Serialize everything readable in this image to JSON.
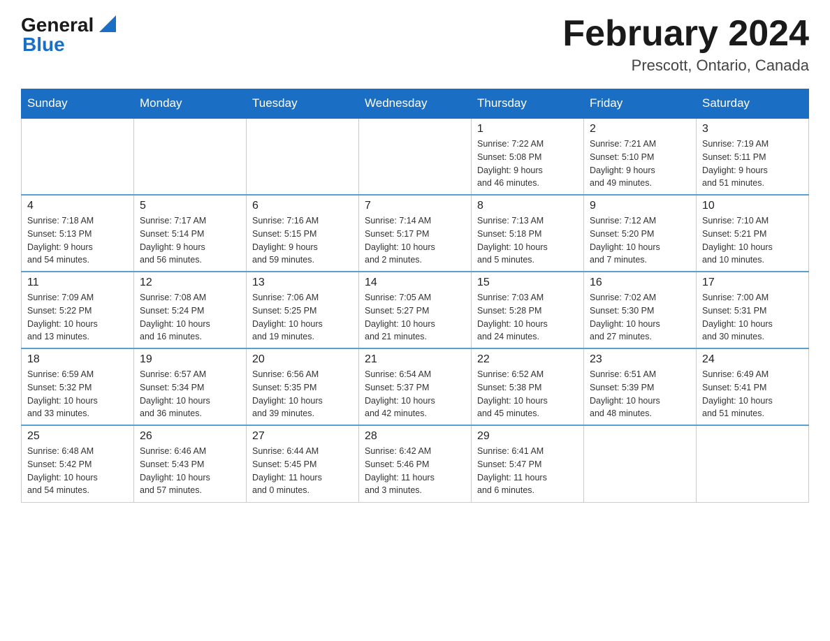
{
  "header": {
    "logo_general": "General",
    "logo_blue": "Blue",
    "month_title": "February 2024",
    "location": "Prescott, Ontario, Canada"
  },
  "weekdays": [
    "Sunday",
    "Monday",
    "Tuesday",
    "Wednesday",
    "Thursday",
    "Friday",
    "Saturday"
  ],
  "weeks": [
    [
      {
        "day": "",
        "info": ""
      },
      {
        "day": "",
        "info": ""
      },
      {
        "day": "",
        "info": ""
      },
      {
        "day": "",
        "info": ""
      },
      {
        "day": "1",
        "info": "Sunrise: 7:22 AM\nSunset: 5:08 PM\nDaylight: 9 hours\nand 46 minutes."
      },
      {
        "day": "2",
        "info": "Sunrise: 7:21 AM\nSunset: 5:10 PM\nDaylight: 9 hours\nand 49 minutes."
      },
      {
        "day": "3",
        "info": "Sunrise: 7:19 AM\nSunset: 5:11 PM\nDaylight: 9 hours\nand 51 minutes."
      }
    ],
    [
      {
        "day": "4",
        "info": "Sunrise: 7:18 AM\nSunset: 5:13 PM\nDaylight: 9 hours\nand 54 minutes."
      },
      {
        "day": "5",
        "info": "Sunrise: 7:17 AM\nSunset: 5:14 PM\nDaylight: 9 hours\nand 56 minutes."
      },
      {
        "day": "6",
        "info": "Sunrise: 7:16 AM\nSunset: 5:15 PM\nDaylight: 9 hours\nand 59 minutes."
      },
      {
        "day": "7",
        "info": "Sunrise: 7:14 AM\nSunset: 5:17 PM\nDaylight: 10 hours\nand 2 minutes."
      },
      {
        "day": "8",
        "info": "Sunrise: 7:13 AM\nSunset: 5:18 PM\nDaylight: 10 hours\nand 5 minutes."
      },
      {
        "day": "9",
        "info": "Sunrise: 7:12 AM\nSunset: 5:20 PM\nDaylight: 10 hours\nand 7 minutes."
      },
      {
        "day": "10",
        "info": "Sunrise: 7:10 AM\nSunset: 5:21 PM\nDaylight: 10 hours\nand 10 minutes."
      }
    ],
    [
      {
        "day": "11",
        "info": "Sunrise: 7:09 AM\nSunset: 5:22 PM\nDaylight: 10 hours\nand 13 minutes."
      },
      {
        "day": "12",
        "info": "Sunrise: 7:08 AM\nSunset: 5:24 PM\nDaylight: 10 hours\nand 16 minutes."
      },
      {
        "day": "13",
        "info": "Sunrise: 7:06 AM\nSunset: 5:25 PM\nDaylight: 10 hours\nand 19 minutes."
      },
      {
        "day": "14",
        "info": "Sunrise: 7:05 AM\nSunset: 5:27 PM\nDaylight: 10 hours\nand 21 minutes."
      },
      {
        "day": "15",
        "info": "Sunrise: 7:03 AM\nSunset: 5:28 PM\nDaylight: 10 hours\nand 24 minutes."
      },
      {
        "day": "16",
        "info": "Sunrise: 7:02 AM\nSunset: 5:30 PM\nDaylight: 10 hours\nand 27 minutes."
      },
      {
        "day": "17",
        "info": "Sunrise: 7:00 AM\nSunset: 5:31 PM\nDaylight: 10 hours\nand 30 minutes."
      }
    ],
    [
      {
        "day": "18",
        "info": "Sunrise: 6:59 AM\nSunset: 5:32 PM\nDaylight: 10 hours\nand 33 minutes."
      },
      {
        "day": "19",
        "info": "Sunrise: 6:57 AM\nSunset: 5:34 PM\nDaylight: 10 hours\nand 36 minutes."
      },
      {
        "day": "20",
        "info": "Sunrise: 6:56 AM\nSunset: 5:35 PM\nDaylight: 10 hours\nand 39 minutes."
      },
      {
        "day": "21",
        "info": "Sunrise: 6:54 AM\nSunset: 5:37 PM\nDaylight: 10 hours\nand 42 minutes."
      },
      {
        "day": "22",
        "info": "Sunrise: 6:52 AM\nSunset: 5:38 PM\nDaylight: 10 hours\nand 45 minutes."
      },
      {
        "day": "23",
        "info": "Sunrise: 6:51 AM\nSunset: 5:39 PM\nDaylight: 10 hours\nand 48 minutes."
      },
      {
        "day": "24",
        "info": "Sunrise: 6:49 AM\nSunset: 5:41 PM\nDaylight: 10 hours\nand 51 minutes."
      }
    ],
    [
      {
        "day": "25",
        "info": "Sunrise: 6:48 AM\nSunset: 5:42 PM\nDaylight: 10 hours\nand 54 minutes."
      },
      {
        "day": "26",
        "info": "Sunrise: 6:46 AM\nSunset: 5:43 PM\nDaylight: 10 hours\nand 57 minutes."
      },
      {
        "day": "27",
        "info": "Sunrise: 6:44 AM\nSunset: 5:45 PM\nDaylight: 11 hours\nand 0 minutes."
      },
      {
        "day": "28",
        "info": "Sunrise: 6:42 AM\nSunset: 5:46 PM\nDaylight: 11 hours\nand 3 minutes."
      },
      {
        "day": "29",
        "info": "Sunrise: 6:41 AM\nSunset: 5:47 PM\nDaylight: 11 hours\nand 6 minutes."
      },
      {
        "day": "",
        "info": ""
      },
      {
        "day": "",
        "info": ""
      }
    ]
  ]
}
